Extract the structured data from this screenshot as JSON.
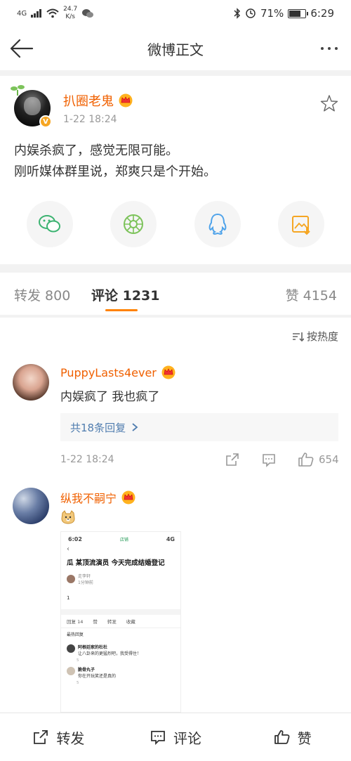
{
  "status_bar": {
    "network": "4G",
    "speed_value": "24.7",
    "speed_unit": "K/s",
    "battery": "71%",
    "time": "6:29"
  },
  "header": {
    "title": "微博正文"
  },
  "post": {
    "username": "扒圈老鬼",
    "time": "1-22 18:24",
    "verified_badge": "V",
    "text_line1": "内娱杀疯了，感觉无限可能。",
    "text_line2": "刚听媒体群里说，郑爽只是个开始。",
    "share_icons": [
      "wechat-icon",
      "moments-icon",
      "qq-icon",
      "save-image-icon"
    ]
  },
  "tabs": {
    "repost": "转发 800",
    "comments": "评论 1231",
    "likes": "赞 4154"
  },
  "sort_label": "按热度",
  "comments": [
    {
      "username": "PuppyLasts4ever",
      "text": "内娱疯了 我也疯了",
      "replies_label": "共18条回复",
      "time": "1-22 18:24",
      "like_count": "654"
    },
    {
      "username": "纵我不嗣宁",
      "embedded_screenshot": {
        "time": "6:02",
        "app_label": "店铺",
        "signal": "4G",
        "title": "瓜 某顶流演员 今天完成结婚登记",
        "author": "走李轩",
        "author_sub": "1分钟前",
        "body": "1",
        "tabs": [
          "回复 14",
          "赞",
          "转发",
          "收藏"
        ],
        "sub_header": "最热回复",
        "replies": [
          {
            "name": "阿根廷家的杜杜",
            "text": "让八卦来的更猛烈吧，我受得住！",
            "likes": "5"
          },
          {
            "name": "脆骨丸子",
            "text": "你在开玩笑还是真的",
            "likes": "5"
          }
        ]
      }
    }
  ],
  "bottom_bar": {
    "repost": "转发",
    "comment": "评论",
    "like": "赞"
  },
  "colors": {
    "accent": "#ff8200",
    "username": "#f06000",
    "link": "#507daf"
  }
}
